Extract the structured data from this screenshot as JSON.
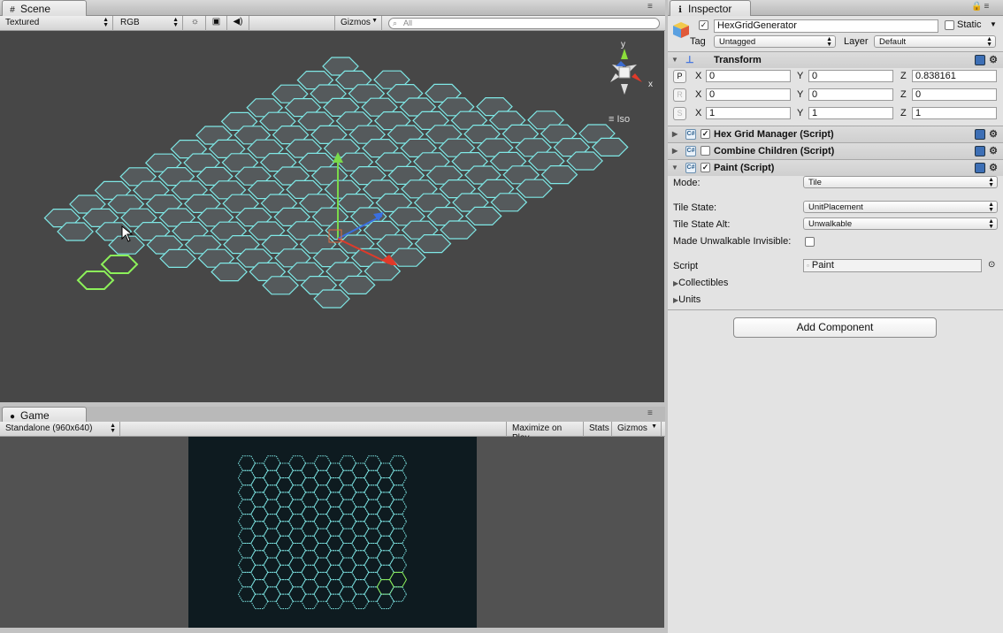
{
  "scene_panel": {
    "tab_label": "Scene",
    "toolbar": {
      "render_mode": "Textured",
      "color_mode": "RGB",
      "gizmos_label": "Gizmos",
      "search_placeholder": "All"
    },
    "projection_label": "Iso",
    "orientation_axes": {
      "y": "y",
      "x": "x"
    }
  },
  "game_panel": {
    "tab_label": "Game",
    "toolbar": {
      "resolution": "Standalone (960x640)",
      "maximize_label": "Maximize on Play",
      "stats_label": "Stats",
      "gizmos_label": "Gizmos"
    }
  },
  "inspector": {
    "tab_label": "Inspector",
    "object": {
      "name": "HexGridGenerator",
      "active": true,
      "static_label": "Static",
      "tag_label": "Tag",
      "tag_value": "Untagged",
      "layer_label": "Layer",
      "layer_value": "Default"
    },
    "transform": {
      "title": "Transform",
      "position": {
        "btn": "P",
        "x": "0",
        "y": "0",
        "z": "0.838161"
      },
      "rotation": {
        "btn": "R",
        "x": "0",
        "y": "0",
        "z": "0"
      },
      "scale": {
        "btn": "S",
        "x": "1",
        "y": "1",
        "z": "1"
      },
      "axis_labels": {
        "x": "X",
        "y": "Y",
        "z": "Z"
      }
    },
    "components": [
      {
        "title": "Hex Grid Manager (Script)",
        "enabled": true
      },
      {
        "title": "Combine Children (Script)",
        "enabled": false
      },
      {
        "title": "Paint (Script)",
        "enabled": true
      }
    ],
    "paint": {
      "mode_label": "Mode:",
      "mode_value": "Tile",
      "tile_state_label": "Tile State:",
      "tile_state_value": "UnitPlacement",
      "tile_state_alt_label": "Tile State Alt:",
      "tile_state_alt_value": "Unwalkable",
      "unwalkable_label": "Made Unwalkable Invisible:",
      "unwalkable_checked": false,
      "script_label": "Script",
      "script_value": "Paint",
      "collectibles_label": "Collectibles",
      "units_label": "Units"
    },
    "add_component_label": "Add Component"
  },
  "colors": {
    "hex_edge": "#7fe8e6",
    "hex_fill": "#555a5c",
    "hex_selected": "#8cf05a",
    "scene_bg": "#474747",
    "game_bg": "#0e1b20"
  }
}
